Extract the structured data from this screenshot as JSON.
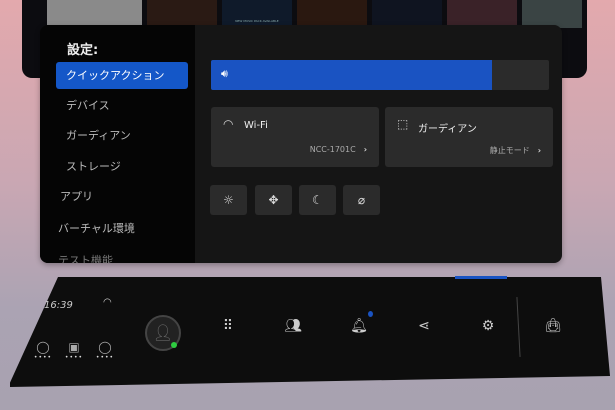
{
  "library": {
    "thumb_text": "NEW MUSIC PACK AVAILABLE"
  },
  "settings": {
    "title": "設定:",
    "nav": [
      {
        "label": "クイックアクション",
        "active": true
      },
      {
        "label": "デバイス"
      },
      {
        "label": "ガーディアン"
      },
      {
        "label": "ストレージ"
      },
      {
        "label": "アプリ"
      },
      {
        "label": "バーチャル環境"
      },
      {
        "label": "テスト機能"
      }
    ],
    "volume": {
      "icon": "speaker-icon",
      "level_percent": 83
    },
    "wifi": {
      "label": "Wi-Fi",
      "network": "NCC-1701C"
    },
    "guardian": {
      "label": "ガーディアン",
      "mode": "静止モード"
    },
    "quick_buttons": [
      "brightness-icon",
      "recenter-icon",
      "night-mode-icon",
      "mic-mute-icon"
    ]
  },
  "bar": {
    "time": "16:39",
    "devices": [
      {
        "name": "left-controller",
        "status": "••••"
      },
      {
        "name": "headset",
        "status": "••••"
      },
      {
        "name": "right-controller",
        "status": "••••"
      }
    ],
    "accent": "#1a53c2",
    "online_color": "#2ecc40"
  }
}
